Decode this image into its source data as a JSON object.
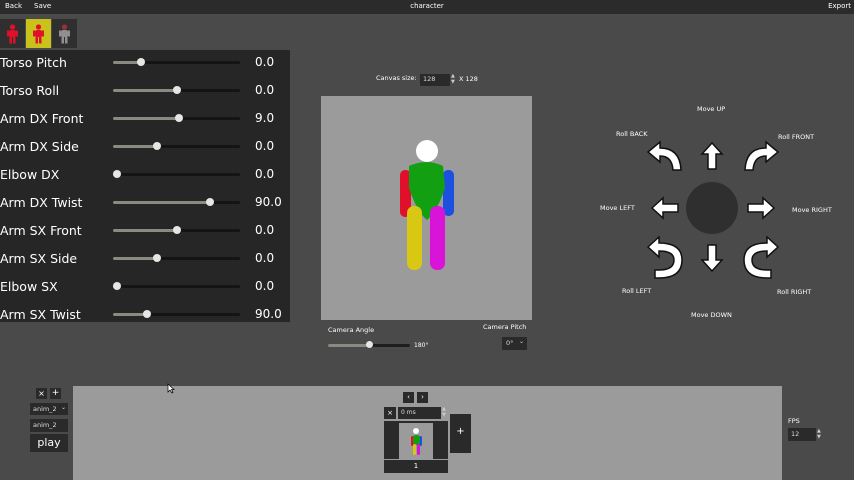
{
  "topbar": {
    "back_label": "Back",
    "save_label": "Save",
    "title": "character",
    "export_label": "Export"
  },
  "tools": [
    {
      "name": "body-tool",
      "color": "#e0102a"
    },
    {
      "name": "pose-tool",
      "color": "#e0102a",
      "active": true,
      "active_color": "#c9c21a"
    },
    {
      "name": "ghost-tool",
      "color": "#c03040"
    }
  ],
  "sliders": [
    {
      "label": "Torso Pitch",
      "value": "0.0",
      "fraction": 0.22
    },
    {
      "label": "Torso Roll",
      "value": "0.0",
      "fraction": 0.5
    },
    {
      "label": "Arm DX Front",
      "value": "9.0",
      "fraction": 0.52
    },
    {
      "label": "Arm DX Side",
      "value": "0.0",
      "fraction": 0.35
    },
    {
      "label": "Elbow DX",
      "value": "0.0",
      "fraction": 0.03
    },
    {
      "label": "Arm DX Twist",
      "value": "90.0",
      "fraction": 0.76
    },
    {
      "label": "Arm SX Front",
      "value": "0.0",
      "fraction": 0.5
    },
    {
      "label": "Arm SX Side",
      "value": "0.0",
      "fraction": 0.35
    },
    {
      "label": "Elbow SX",
      "value": "0.0",
      "fraction": 0.03
    },
    {
      "label": "Arm SX Twist",
      "value": "90.0",
      "fraction": 0.27
    }
  ],
  "canvas": {
    "size_label": "Canvas size:",
    "size_value": "128",
    "size_suffix": "X 128"
  },
  "camera": {
    "angle_label": "Camera Angle",
    "angle_value": "180°",
    "angle_fraction": 0.5,
    "pitch_label": "Camera Pitch",
    "pitch_value": "0°"
  },
  "controls": {
    "move_up": "Move UP",
    "move_down": "Move DOWN",
    "move_left": "Move LEFT",
    "move_right": "Move RIGHT",
    "roll_back": "Roll BACK",
    "roll_front": "Roll FRONT",
    "roll_left": "Roll LEFT",
    "roll_right": "Roll RIGHT"
  },
  "figure_colors": {
    "head": "#ffffff",
    "torso": "#12a012",
    "arm_dx": "#e0102a",
    "arm_sx": "#1e50e0",
    "leg_dx": "#d8c814",
    "leg_sx": "#d814d8"
  },
  "animation": {
    "remove_label": "×",
    "add_label": "+",
    "selected": "anim_2",
    "name_value": "anim_2",
    "play_label": "play"
  },
  "timeline": {
    "prev_label": "‹",
    "next_label": "›",
    "delete_label": "×",
    "frame_field": "0 ms",
    "frame_number": "1",
    "add_frame_label": "+"
  },
  "fps": {
    "label": "FPS",
    "value": "12"
  }
}
